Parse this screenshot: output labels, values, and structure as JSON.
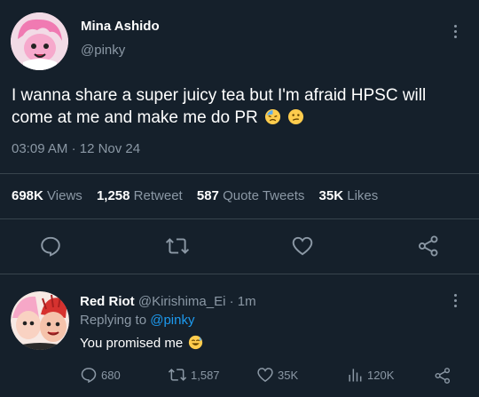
{
  "main_tweet": {
    "display_name": "Mina Ashido",
    "handle": "@pinky",
    "text": "I wanna share a super juicy tea but I'm afraid HPSC will come at me and make me do PR",
    "time": "03:09 AM",
    "date": "12 Nov 24",
    "stats": {
      "views_count": "698K",
      "views_label": "Views",
      "retweets_count": "1,258",
      "retweets_label": "Retweet",
      "quotes_count": "587",
      "quotes_label": "Quote Tweets",
      "likes_count": "35K",
      "likes_label": "Likes"
    },
    "actions": [
      "reply-icon",
      "retweet-icon",
      "like-icon",
      "share-icon"
    ]
  },
  "reply": {
    "display_name": "Red Riot",
    "handle": "@Kirishima_Ei",
    "time": "1m",
    "replying_to_label": "Replying to",
    "replying_to_handle": "@pinky",
    "text": "You promised me",
    "replies": "680",
    "retweets": "1,587",
    "likes": "35K",
    "views": "120K"
  },
  "colors": {
    "background": "#15202b",
    "muted": "#8b98a5",
    "link": "#1d9bf0",
    "divider": "#38444d"
  }
}
